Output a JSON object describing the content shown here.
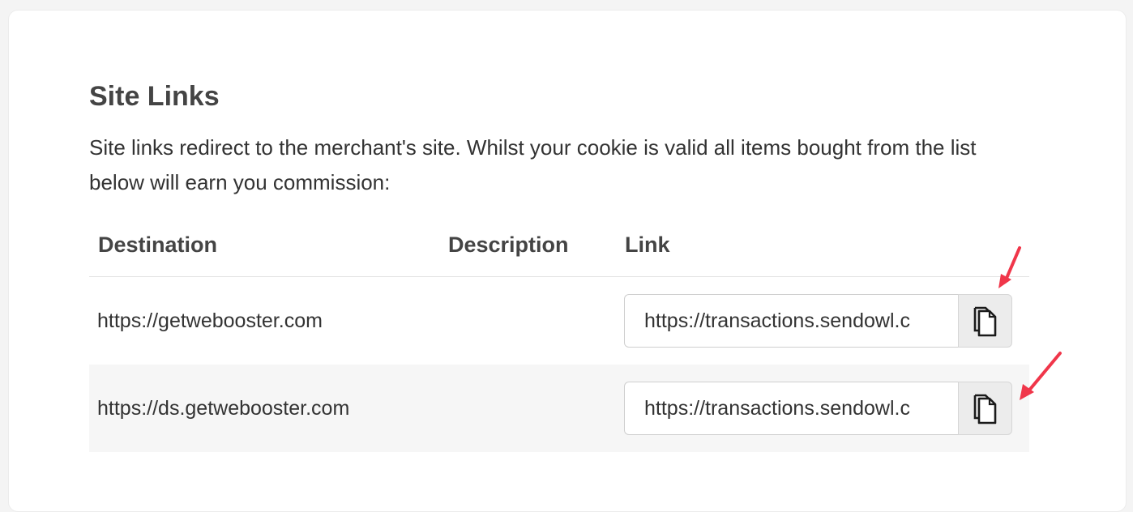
{
  "section": {
    "title": "Site Links",
    "description": "Site links redirect to the merchant's site. Whilst your cookie is valid all items bought from the list below will earn you commission:"
  },
  "table": {
    "headers": {
      "destination": "Destination",
      "description": "Description",
      "link": "Link"
    },
    "rows": [
      {
        "destination": "https://getwebooster.com",
        "description": "",
        "link": "https://transactions.sendowl.c"
      },
      {
        "destination": "https://ds.getwebooster.com",
        "description": "",
        "link": "https://transactions.sendowl.c"
      }
    ]
  },
  "icons": {
    "copy": "copy-icon",
    "annotation": "red-arrow-annotation"
  },
  "colors": {
    "annotation_red": "#f0364a",
    "alt_row_bg": "#f6f6f6",
    "copy_button_bg": "#ececec"
  }
}
